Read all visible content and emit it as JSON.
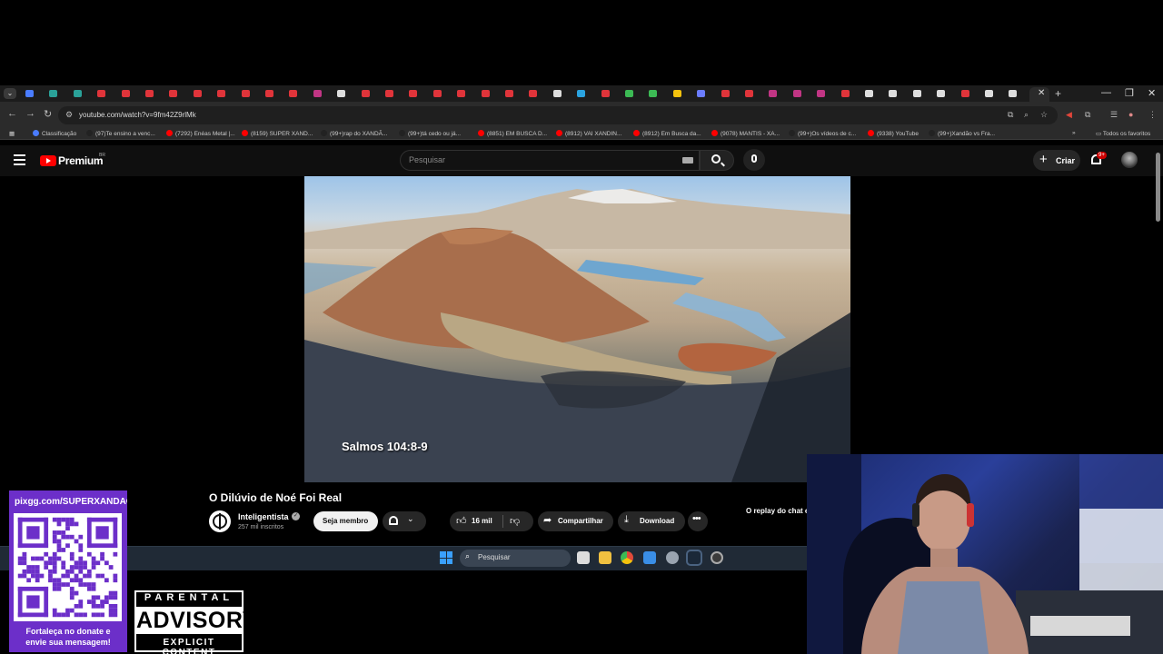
{
  "browser": {
    "url": "youtube.com/watch?v=9fm42Z9rlMk",
    "bookmarks": [
      {
        "label": "Classificação",
        "color": "#4a7cff"
      },
      {
        "label": "(97)Te ensino a venc...",
        "color": "#222222"
      },
      {
        "label": "(7292) Enéas Metal |...",
        "color": "#ff0000"
      },
      {
        "label": "(8159) SUPER XAND...",
        "color": "#ff0000"
      },
      {
        "label": "(99+)rap do XANDÃ...",
        "color": "#222222"
      },
      {
        "label": "(99+)tá cedo ou já...",
        "color": "#222222"
      },
      {
        "label": "(8851) EM BUSCA D...",
        "color": "#ff0000"
      },
      {
        "label": "(8912) VAI XANDIN...",
        "color": "#ff0000"
      },
      {
        "label": "(8912) Em Busca da...",
        "color": "#ff0000"
      },
      {
        "label": "(9078) MANTIS - XA...",
        "color": "#ff0000"
      },
      {
        "label": "(99+)Os vídeos de c...",
        "color": "#222222"
      },
      {
        "label": "(9338) YouTube",
        "color": "#ff0000"
      },
      {
        "label": "(99+)Xandão vs Fra...",
        "color": "#222222"
      }
    ],
    "all_bookmarks": "Todos os favoritos",
    "accent": "#2b2b2b"
  },
  "youtube": {
    "brand": "Premium",
    "region": "BR",
    "search_placeholder": "Pesquisar",
    "create_label": "Criar",
    "notifications": "9+",
    "brand_color": "#ff0000"
  },
  "video": {
    "caption": "Salmos 104:8-9",
    "title": "O Dilúvio de Noé Foi Real",
    "channel": "Inteligentista",
    "subscribers": "257 mil inscritos",
    "member_label": "Seja membro",
    "likes": "16 mil",
    "share_label": "Compartilhar",
    "download_label": "Download",
    "chat_replay": "O replay do chat está desativado"
  },
  "taskbar": {
    "search_label": "Pesquisar"
  },
  "overlay": {
    "qr_url": "pixgg.com/SUPERXANDAO",
    "qr_caption_line1": "Fortaleça no donate e",
    "qr_caption_line2": "envie sua mensagem!",
    "qr_color": "#6c2fc9",
    "advisory_top": "PARENTAL",
    "advisory_mid": "ADVISORY",
    "advisory_bottom": "EXPLICIT CONTENT"
  }
}
